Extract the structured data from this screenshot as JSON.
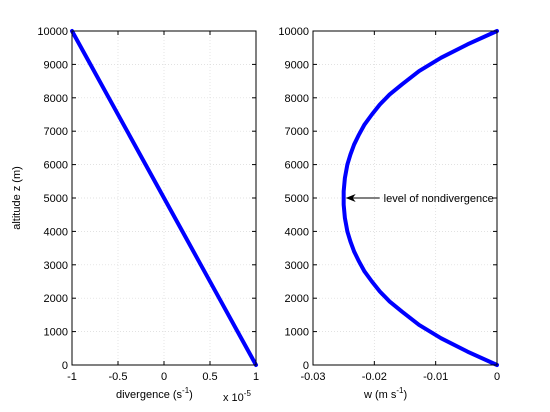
{
  "chart_data": [
    {
      "type": "line",
      "xlabel": "divergence  (s",
      "xlabel_sup": "-1",
      "xlabel_close": ")",
      "x_multiplier": "x 10",
      "x_multiplier_exp": "-5",
      "ylabel": "altitude z (m)",
      "xlim": [
        -1,
        1
      ],
      "ylim": [
        0,
        10000
      ],
      "xticks": [
        "-1",
        "-0.5",
        "0",
        "0.5",
        "1"
      ],
      "yticks": [
        "0",
        "1000",
        "2000",
        "3000",
        "4000",
        "5000",
        "6000",
        "7000",
        "8000",
        "9000",
        "10000"
      ],
      "grid": true,
      "series": [
        {
          "color": "#0000ff",
          "x": [
            1,
            0.8,
            0.6,
            0.4,
            0.2,
            0,
            -0.2,
            -0.4,
            -0.6,
            -0.8,
            -1
          ],
          "y": [
            0,
            1000,
            2000,
            3000,
            4000,
            5000,
            6000,
            7000,
            8000,
            9000,
            10000
          ]
        }
      ]
    },
    {
      "type": "line",
      "xlabel": "w  (m s",
      "xlabel_sup": "-1",
      "xlabel_close": ")",
      "xlim": [
        -0.03,
        0
      ],
      "ylim": [
        0,
        10000
      ],
      "xticks": [
        "-0.03",
        "-0.02",
        "-0.01",
        "0"
      ],
      "yticks": [
        "0",
        "1000",
        "2000",
        "3000",
        "4000",
        "5000",
        "6000",
        "7000",
        "8000",
        "9000",
        "10000"
      ],
      "grid": true,
      "annotation": {
        "text": "level of nondivergence",
        "x": -0.025,
        "y": 5000
      },
      "series": [
        {
          "color": "#0000ff",
          "x": [
            0,
            -0.0048,
            -0.0091,
            -0.0127,
            -0.0155,
            -0.0175,
            -0.0191,
            -0.0204,
            -0.0216,
            -0.0225,
            -0.0233,
            -0.0239,
            -0.0244,
            -0.0248,
            -0.025,
            -0.025,
            -0.0248,
            -0.0244,
            -0.0239,
            -0.0233,
            -0.0225,
            -0.0216,
            -0.0204,
            -0.0191,
            -0.0175,
            -0.0155,
            -0.0127,
            -0.0091,
            -0.0048,
            0
          ],
          "y": [
            0,
            400,
            800,
            1200,
            1600,
            1900,
            2200,
            2500,
            2800,
            3100,
            3400,
            3700,
            4000,
            4400,
            4800,
            5200,
            5600,
            6000,
            6300,
            6600,
            6900,
            7200,
            7500,
            7800,
            8100,
            8400,
            8800,
            9200,
            9600,
            10000
          ]
        }
      ]
    }
  ]
}
